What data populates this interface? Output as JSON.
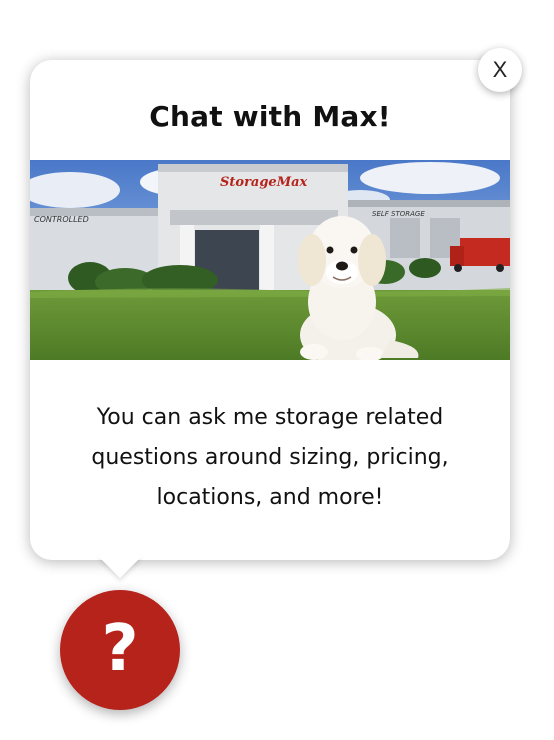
{
  "popup": {
    "title": "Chat with Max!",
    "close_label": "X",
    "message_lines": [
      "You can ask me storage related",
      "questions around sizing, pricing,",
      "locations, and more!"
    ],
    "photo": {
      "sign_text": "StorageMax",
      "left_sign_text": "CONTROLLED",
      "right_sign_text": "SELF STORAGE"
    }
  },
  "launcher": {
    "glyph": "?",
    "icon": "question-icon",
    "color": "#b5231b"
  }
}
